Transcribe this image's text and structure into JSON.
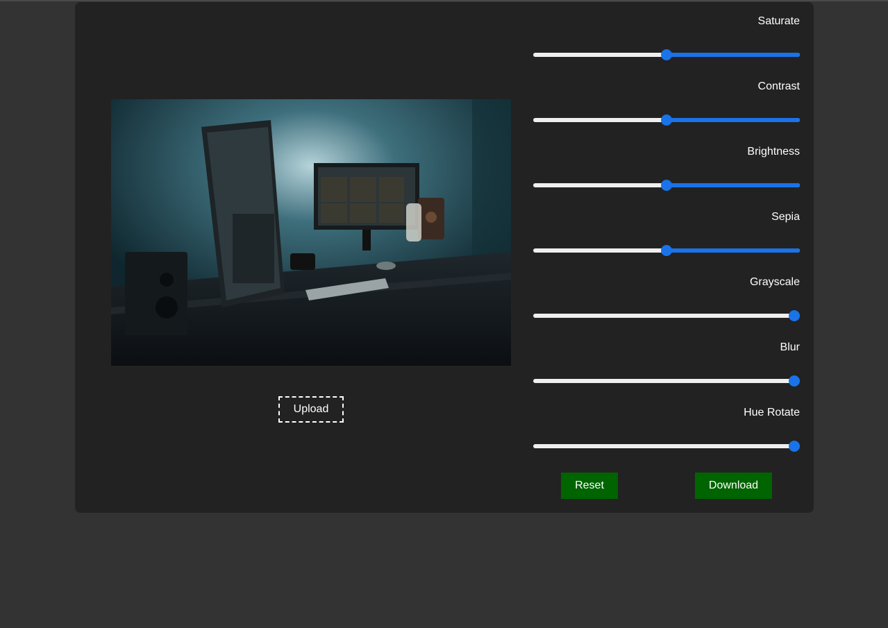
{
  "upload_label": "Upload",
  "filters": [
    {
      "label": "Saturate",
      "value_fraction": 0.5
    },
    {
      "label": "Contrast",
      "value_fraction": 0.5
    },
    {
      "label": "Brightness",
      "value_fraction": 0.5
    },
    {
      "label": "Sepia",
      "value_fraction": 0.5
    },
    {
      "label": "Grayscale",
      "value_fraction": 1.0
    },
    {
      "label": "Blur",
      "value_fraction": 1.0
    },
    {
      "label": "Hue Rotate",
      "value_fraction": 1.0
    }
  ],
  "buttons": {
    "reset_label": "Reset",
    "download_label": "Download"
  },
  "colors": {
    "accent": "#1a73e8",
    "button": "#006400",
    "panel": "#222222",
    "background": "#333333"
  }
}
